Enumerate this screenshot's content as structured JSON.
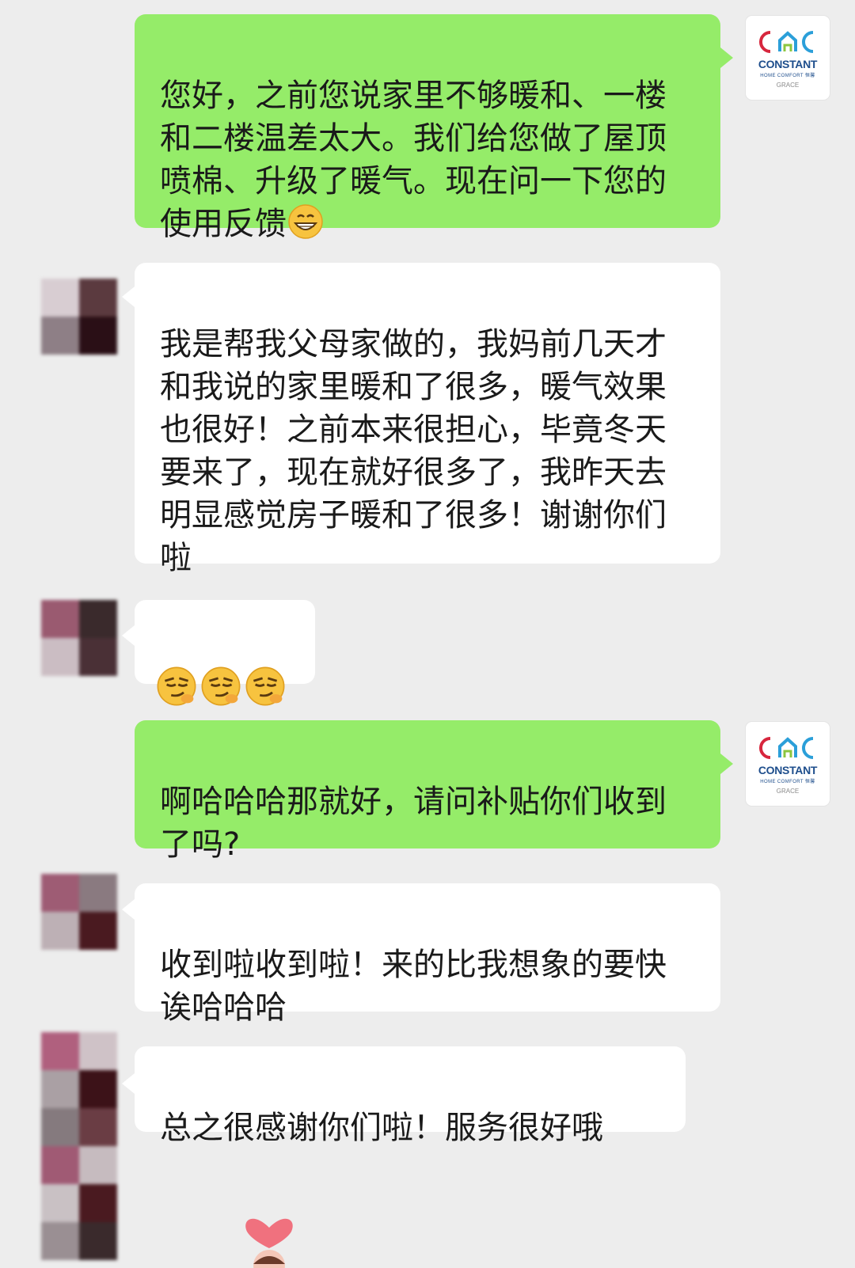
{
  "contact": {
    "brand_mark": "CAC",
    "brand_name": "CONSTANT",
    "brand_tagline": "HOME COMFORT 恒馨",
    "agent_name": "GRACE"
  },
  "messages": [
    {
      "side": "out",
      "text": "您好，之前您说家里不够暖和、一楼和二楼温差太大。我们给您做了屋顶喷棉、升级了暖气。现在问一下您的使用反馈",
      "emoji": "grin"
    },
    {
      "side": "in",
      "text": "我是帮我父母家做的，我妈前几天才和我说的家里暖和了很多，暖气效果也很好！之前本来很担心，毕竟冬天要来了，现在就好很多了，我昨天去明显感觉房子暖和了很多！谢谢你们啦"
    },
    {
      "side": "in",
      "emoji_only": [
        "smirk",
        "smirk",
        "smirk"
      ]
    },
    {
      "side": "out",
      "text": "啊哈哈哈那就好，请问补贴你们收到了吗?"
    },
    {
      "side": "in",
      "text": "收到啦收到啦！来的比我想象的要快诶哈哈哈"
    },
    {
      "side": "in",
      "text": "总之很感谢你们啦！服务很好哦"
    }
  ],
  "colors": {
    "background": "#ededed",
    "outgoing_bubble": "#95ec69",
    "incoming_bubble": "#ffffff"
  }
}
